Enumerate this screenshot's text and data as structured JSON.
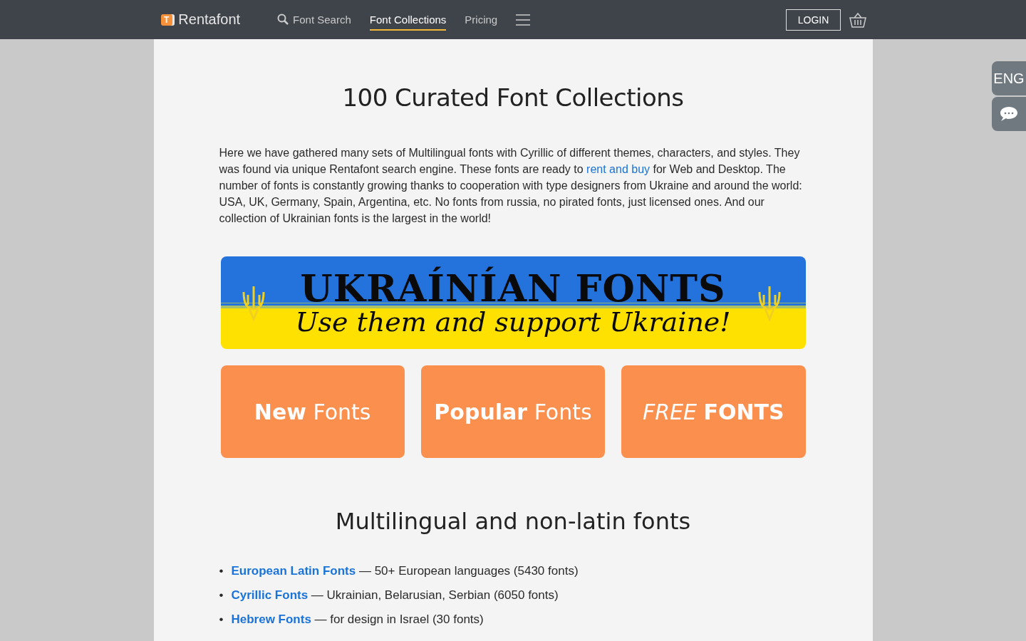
{
  "header": {
    "logo": "Rentafont",
    "logo_mark": "T",
    "nav": [
      {
        "label": "Font Search",
        "selected": false,
        "kind": "search"
      },
      {
        "label": "Font Collections",
        "selected": true,
        "kind": "link"
      },
      {
        "label": "Pricing",
        "selected": false,
        "kind": "link"
      }
    ],
    "login": "LOGIN"
  },
  "side": {
    "language": "ENG"
  },
  "title": "100 Curated Font Collections",
  "intro": {
    "before": "Here we have gathered many sets of Multilingual fonts with Cyrillic of different themes, characters, and styles. They was found via unique Rentafont search engine. These fonts are ready to ",
    "link": "rent and buy",
    "after": " for Web and Desktop. The number of fonts is constantly growing thanks to cooperation with type designers from Ukraine and around the world: USA, UK, Germany, Spain, Argentina, etc. No fonts from russia, no pirated fonts, just licensed ones. And our collection of Ukrainian fonts is the largest in the world!"
  },
  "banner": {
    "headline": "UKRAÍNÍAN FONTS",
    "tagline": "Use them and support Ukraine!"
  },
  "tiles": [
    {
      "label": "**New** Fonts"
    },
    {
      "label": "**Popular** Fonts"
    },
    {
      "label": "*FREE* **FONTS**"
    }
  ],
  "section_title": "Multilingual and non-latin fonts",
  "list": [
    {
      "bullet": "•",
      "link": "European Latin Fonts",
      "text": " — 50+ European languages (5430 fonts)"
    },
    {
      "bullet": "•",
      "link": "Cyrillic Fonts",
      "text": " — Ukrainian, Belarusian, Serbian (6050 fonts)"
    },
    {
      "bullet": "•",
      "link": "Hebrew Fonts",
      "text": " — for design in Israel (30 fonts)"
    }
  ]
}
